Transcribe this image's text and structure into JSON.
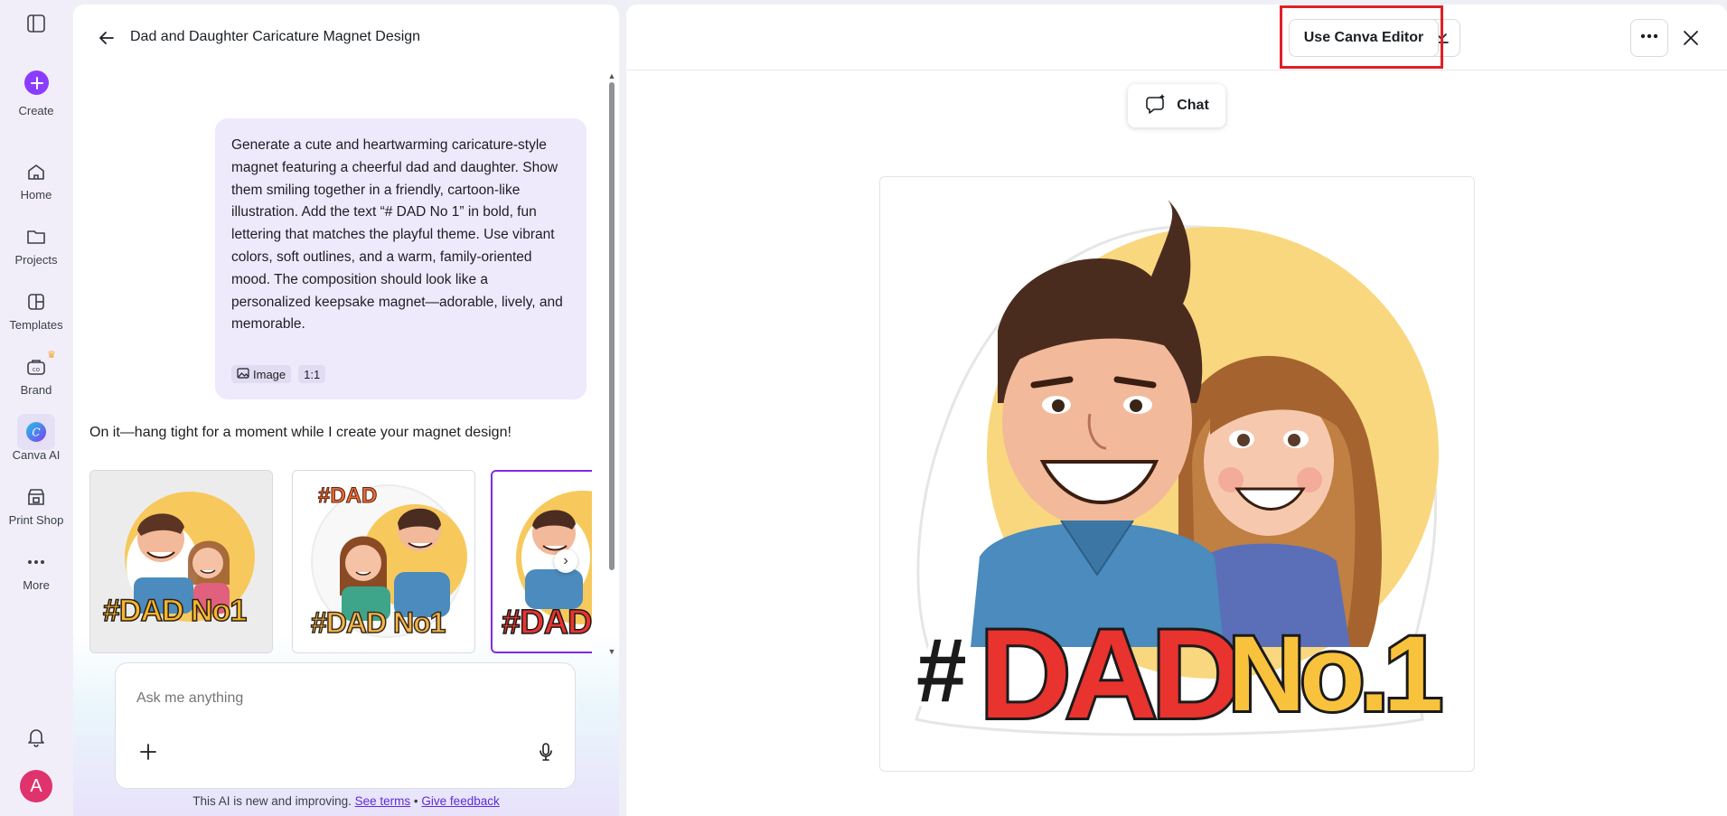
{
  "sidebar": {
    "create_label": "Create",
    "items": [
      {
        "label": "Home",
        "icon": "home-icon"
      },
      {
        "label": "Projects",
        "icon": "folder-icon"
      },
      {
        "label": "Templates",
        "icon": "templates-icon"
      },
      {
        "label": "Brand",
        "icon": "brand-icon"
      },
      {
        "label": "Canva AI",
        "icon": "canva-ai-icon"
      },
      {
        "label": "Print Shop",
        "icon": "print-shop-icon"
      },
      {
        "label": "More",
        "icon": "more-icon"
      }
    ],
    "avatar_initial": "A",
    "accent": "#8b3dff"
  },
  "chat": {
    "title": "Dad and Daughter Caricature Magnet Design",
    "user_message": "Generate a cute and heartwarming caricature-style magnet featuring a cheerful dad and daughter. Show them smiling together in a friendly, cartoon-like illustration. Add the text “# DAD No 1” in bold, fun lettering that matches the playful theme. Use vibrant colors, soft outlines, and a warm, family-oriented mood. The composition should look like a personalized keepsake magnet—adorable, lively, and memorable.",
    "chips": {
      "image": "Image",
      "ratio": "1:1"
    },
    "ai_reply": "On it—hang tight for a moment while I create your magnet design!",
    "thumbnails": [
      {
        "text_line": "#DAD No1",
        "selected": false
      },
      {
        "text_line": "#DAD No1",
        "selected": false
      },
      {
        "text_line": "#DAD",
        "selected": true
      }
    ],
    "input_placeholder": "Ask me anything",
    "footer": {
      "text": "This AI is new and improving.",
      "terms_link": "See terms",
      "separator": "•",
      "feedback_link": "Give feedback"
    }
  },
  "preview": {
    "use_editor_label": "Use Canva Editor",
    "chat_toggle_label": "Chat",
    "highlight_color": "#e01f26",
    "artwork": {
      "text_dad": "#DAD",
      "text_no": "No.1",
      "dad_color": "#e8332f",
      "no_color": "#f9c23c",
      "background_circle": "#f9d77e"
    }
  }
}
